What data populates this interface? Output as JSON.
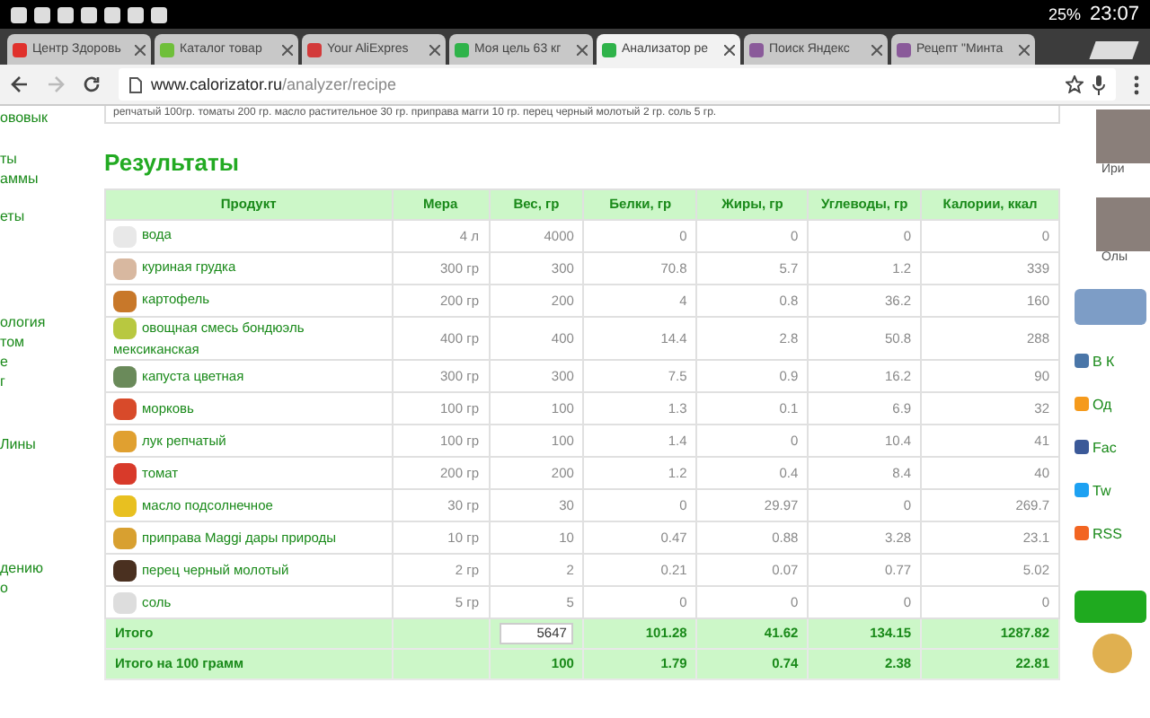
{
  "status_bar": {
    "battery": "25%",
    "time": "23:07"
  },
  "tabs": [
    {
      "title": "Центр Здоровь",
      "selected": false,
      "color": "#e0312c"
    },
    {
      "title": "Каталог товар",
      "selected": false,
      "color": "#6fbf3a"
    },
    {
      "title": "Your AliExpres",
      "selected": false,
      "color": "#d33a3a"
    },
    {
      "title": "Моя цель 63 кг",
      "selected": false,
      "color": "#2fb34a"
    },
    {
      "title": "Анализатор ре",
      "selected": true,
      "color": "#2fb34a"
    },
    {
      "title": "Поиск Яндекс",
      "selected": false,
      "color": "#8a5a9a"
    },
    {
      "title": "Рецепт \"Минта",
      "selected": false,
      "color": "#8a5a9a"
    }
  ],
  "address": {
    "host": "www.calorizator.ru",
    "path": "/analyzer/recipe"
  },
  "left_menu": [
    "ововык",
    "ты",
    "аммы",
    "еты",
    "ология",
    "том",
    "е",
    "г",
    "Лины",
    "дению",
    "о"
  ],
  "recipe_text": "репчатый 100гр. томаты 200 гр. масло растительное 30 гр. приправа магги 10 гр. перец черный молотый 2 гр. соль 5 гр.",
  "results_title": "Результаты",
  "table": {
    "columns": [
      "Продукт",
      "Мера",
      "Вес, гр",
      "Белки, гр",
      "Жиры, гр",
      "Углеводы, гр",
      "Калории, ккал"
    ],
    "rows": [
      {
        "product": "вода",
        "measure": "4 л",
        "weight": "4000",
        "protein": "0",
        "fat": "0",
        "carbs": "0",
        "kcal": "0"
      },
      {
        "product": "куриная грудка",
        "measure": "300 гр",
        "weight": "300",
        "protein": "70.8",
        "fat": "5.7",
        "carbs": "1.2",
        "kcal": "339"
      },
      {
        "product": "картофель",
        "measure": "200 гр",
        "weight": "200",
        "protein": "4",
        "fat": "0.8",
        "carbs": "36.2",
        "kcal": "160"
      },
      {
        "product": "овощная смесь бондюэль мексиканская",
        "measure": "400 гр",
        "weight": "400",
        "protein": "14.4",
        "fat": "2.8",
        "carbs": "50.8",
        "kcal": "288"
      },
      {
        "product": "капуста цветная",
        "measure": "300 гр",
        "weight": "300",
        "protein": "7.5",
        "fat": "0.9",
        "carbs": "16.2",
        "kcal": "90"
      },
      {
        "product": "морковь",
        "measure": "100 гр",
        "weight": "100",
        "protein": "1.3",
        "fat": "0.1",
        "carbs": "6.9",
        "kcal": "32"
      },
      {
        "product": "лук репчатый",
        "measure": "100 гр",
        "weight": "100",
        "protein": "1.4",
        "fat": "0",
        "carbs": "10.4",
        "kcal": "41"
      },
      {
        "product": "томат",
        "measure": "200 гр",
        "weight": "200",
        "protein": "1.2",
        "fat": "0.4",
        "carbs": "8.4",
        "kcal": "40"
      },
      {
        "product": "масло подсолнечное",
        "measure": "30 гр",
        "weight": "30",
        "protein": "0",
        "fat": "29.97",
        "carbs": "0",
        "kcal": "269.7"
      },
      {
        "product": "приправа Maggi дары природы",
        "measure": "10 гр",
        "weight": "10",
        "protein": "0.47",
        "fat": "0.88",
        "carbs": "3.28",
        "kcal": "23.1"
      },
      {
        "product": "перец черный молотый",
        "measure": "2 гр",
        "weight": "2",
        "protein": "0.21",
        "fat": "0.07",
        "carbs": "0.77",
        "kcal": "5.02"
      },
      {
        "product": "соль",
        "measure": "5 гр",
        "weight": "5",
        "protein": "0",
        "fat": "0",
        "carbs": "0",
        "kcal": "0"
      }
    ],
    "totals": [
      {
        "label": "Итого",
        "weight": "5647",
        "protein": "101.28",
        "fat": "41.62",
        "carbs": "134.15",
        "kcal": "1287.82"
      },
      {
        "label": "Итого на 100 грамм",
        "weight": "100",
        "protein": "1.79",
        "fat": "0.74",
        "carbs": "2.38",
        "kcal": "22.81"
      }
    ]
  },
  "right_sidebar": {
    "people": [
      "Ири",
      "Олы"
    ],
    "links": [
      {
        "label": "В К",
        "color": "#4a76a8"
      },
      {
        "label": "Од",
        "color": "#f59a1c"
      },
      {
        "label": "Fac",
        "color": "#3b5998"
      },
      {
        "label": "Tw",
        "color": "#1da1f2"
      },
      {
        "label": "RSS",
        "color": "#f26522"
      }
    ]
  }
}
